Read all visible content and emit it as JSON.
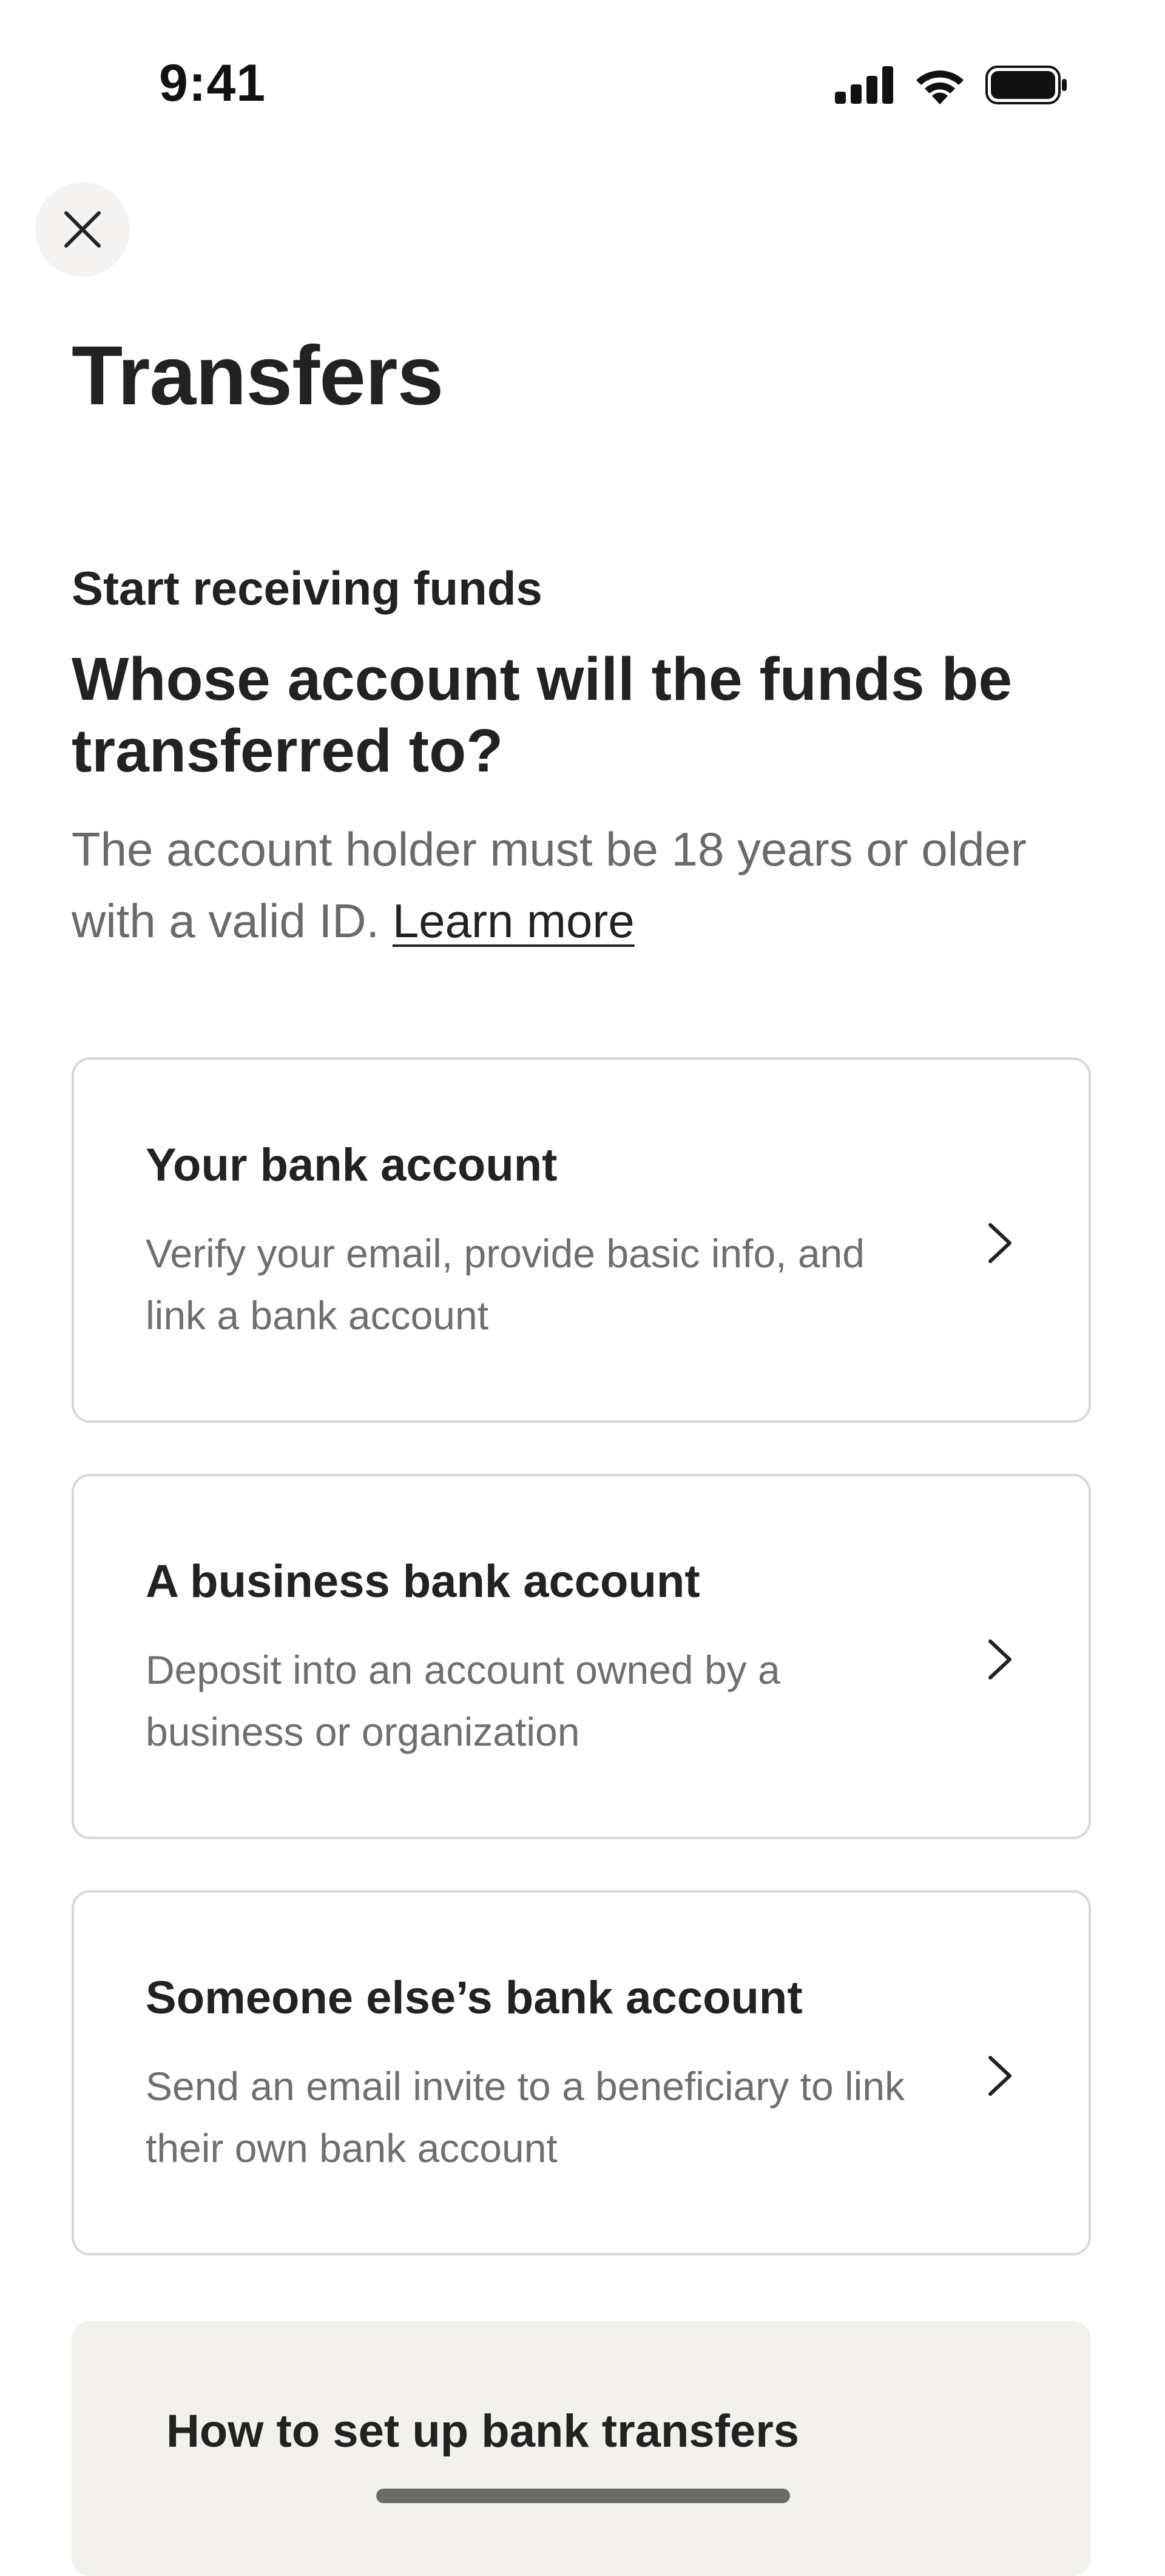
{
  "status_bar": {
    "time": "9:41",
    "icons": [
      "cellular-signal-icon",
      "wifi-icon",
      "battery-icon"
    ]
  },
  "header": {
    "close_icon": "close-icon",
    "title": "Transfers"
  },
  "intro": {
    "section_label": "Start receiving funds",
    "question": "Whose account will the funds be transferred to?",
    "description": "The account holder must be 18 years or older with a valid ID.",
    "learn_more": "Learn more"
  },
  "options": [
    {
      "title": "Your bank account",
      "description": "Verify your email, provide basic info, and link a bank account",
      "icon": "chevron-right-icon"
    },
    {
      "title": "A business bank account",
      "description": "Deposit into an account owned by a business or organization",
      "icon": "chevron-right-icon"
    },
    {
      "title": "Someone else’s bank account",
      "description": "Send an email invite to a beneficiary to link their own bank account",
      "icon": "chevron-right-icon"
    }
  ],
  "help_card": {
    "title": "How to set up bank transfers"
  },
  "colors": {
    "text_primary": "#222222",
    "text_secondary": "#6a6a6a",
    "card_border": "#d8d8d8",
    "help_card_bg": "#f2f1ed",
    "close_button_bg": "#f4f3f1"
  }
}
